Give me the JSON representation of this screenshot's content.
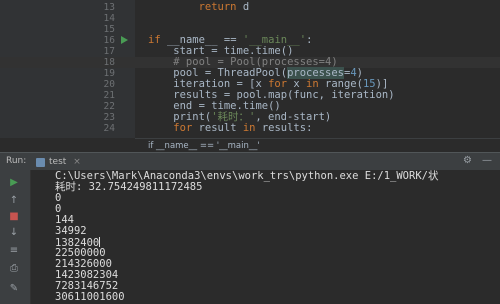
{
  "editor": {
    "lines": [
      {
        "n": "13",
        "segments": [
          {
            "t": "        "
          },
          {
            "t": "return",
            "c": "kw"
          },
          {
            "t": " d"
          }
        ]
      },
      {
        "n": "14",
        "segments": [
          {
            "t": ""
          }
        ]
      },
      {
        "n": "15",
        "segments": [
          {
            "t": ""
          }
        ]
      },
      {
        "n": "16",
        "segments": [
          {
            "t": "if",
            "c": "kw"
          },
          {
            "t": " __name__ == "
          },
          {
            "t": "'__main__'",
            "c": "str"
          },
          {
            "t": ":"
          }
        ]
      },
      {
        "n": "17",
        "segments": [
          {
            "t": "    start = time.time()"
          }
        ]
      },
      {
        "n": "18",
        "segments": [
          {
            "t": "    # pool = Pool(processes=4)",
            "c": "cmt"
          }
        ]
      },
      {
        "n": "19",
        "segments": [
          {
            "t": "    pool = ThreadPool("
          },
          {
            "t": "processes",
            "c": "hl"
          },
          {
            "t": "="
          },
          {
            "t": "4",
            "c": "num"
          },
          {
            "t": ")"
          }
        ]
      },
      {
        "n": "20",
        "segments": [
          {
            "t": "    iteration = [x "
          },
          {
            "t": "for",
            "c": "kw"
          },
          {
            "t": " x "
          },
          {
            "t": "in",
            "c": "kw"
          },
          {
            "t": " range("
          },
          {
            "t": "15",
            "c": "num"
          },
          {
            "t": ")]"
          }
        ]
      },
      {
        "n": "21",
        "segments": [
          {
            "t": "    results = pool.map(func, iteration)"
          }
        ]
      },
      {
        "n": "22",
        "segments": [
          {
            "t": "    end = time.time()"
          }
        ]
      },
      {
        "n": "23",
        "segments": [
          {
            "t": "    print("
          },
          {
            "t": "'耗时：'",
            "c": "str"
          },
          {
            "t": ", end-start)"
          }
        ]
      },
      {
        "n": "24",
        "segments": [
          {
            "t": "    "
          },
          {
            "t": "for",
            "c": "kw"
          },
          {
            "t": " result "
          },
          {
            "t": "in",
            "c": "kw"
          },
          {
            "t": " results:"
          }
        ]
      }
    ],
    "breadcrumb": "if __name__ == '__main__'"
  },
  "run": {
    "label": "Run:",
    "tab_name": "test",
    "tab_close": "×",
    "settings_icon": "⚙",
    "hide_icon": "—"
  },
  "console": {
    "lines": [
      "C:\\Users\\Mark\\Anaconda3\\envs\\work_trs\\python.exe E:/1_WORK/状",
      "耗时: 32.754249811172485",
      "0",
      "0",
      "144",
      "34992",
      "1382400",
      "22500000",
      "214326000",
      "1423082304",
      "7283146752",
      "30611001600"
    ]
  },
  "colors": {
    "keyword": "#cc7832",
    "string": "#6a8759",
    "number": "#6897bb",
    "comment": "#808080"
  }
}
